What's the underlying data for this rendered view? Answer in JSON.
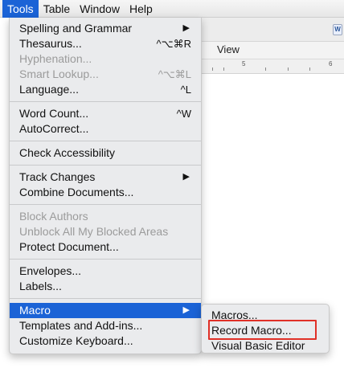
{
  "menubar": {
    "items": [
      {
        "label": "Tools",
        "active": true
      },
      {
        "label": "Table",
        "active": false
      },
      {
        "label": "Window",
        "active": false
      },
      {
        "label": "Help",
        "active": false
      }
    ]
  },
  "document": {
    "view_tab": "View",
    "ruler_numbers": [
      "5",
      "6"
    ],
    "app_icon_letter": "W"
  },
  "tools_menu": {
    "groups": [
      [
        {
          "label": "Spelling and Grammar",
          "submenu": true
        },
        {
          "label": "Thesaurus...",
          "shortcut": "^⌥⌘R"
        },
        {
          "label": "Hyphenation...",
          "disabled": true
        },
        {
          "label": "Smart Lookup...",
          "shortcut": "^⌥⌘L",
          "disabled": true
        },
        {
          "label": "Language...",
          "shortcut": "^L"
        }
      ],
      [
        {
          "label": "Word Count...",
          "shortcut": "^W"
        },
        {
          "label": "AutoCorrect..."
        }
      ],
      [
        {
          "label": "Check Accessibility"
        }
      ],
      [
        {
          "label": "Track Changes",
          "submenu": true
        },
        {
          "label": "Combine Documents..."
        }
      ],
      [
        {
          "label": "Block Authors",
          "disabled": true
        },
        {
          "label": "Unblock All My Blocked Areas",
          "disabled": true
        },
        {
          "label": "Protect Document..."
        }
      ],
      [
        {
          "label": "Envelopes..."
        },
        {
          "label": "Labels..."
        }
      ],
      [
        {
          "label": "Macro",
          "submenu": true,
          "highlighted": true
        },
        {
          "label": "Templates and Add-ins..."
        },
        {
          "label": "Customize Keyboard..."
        }
      ]
    ]
  },
  "macro_submenu": {
    "items": [
      {
        "label": "Macros..."
      },
      {
        "label": "Record Macro...",
        "annotated": true
      },
      {
        "label": "Visual Basic Editor"
      }
    ]
  },
  "colors": {
    "highlight": "#1b63d6",
    "annotation": "#e03027",
    "menu_bg": "#eaebed"
  }
}
